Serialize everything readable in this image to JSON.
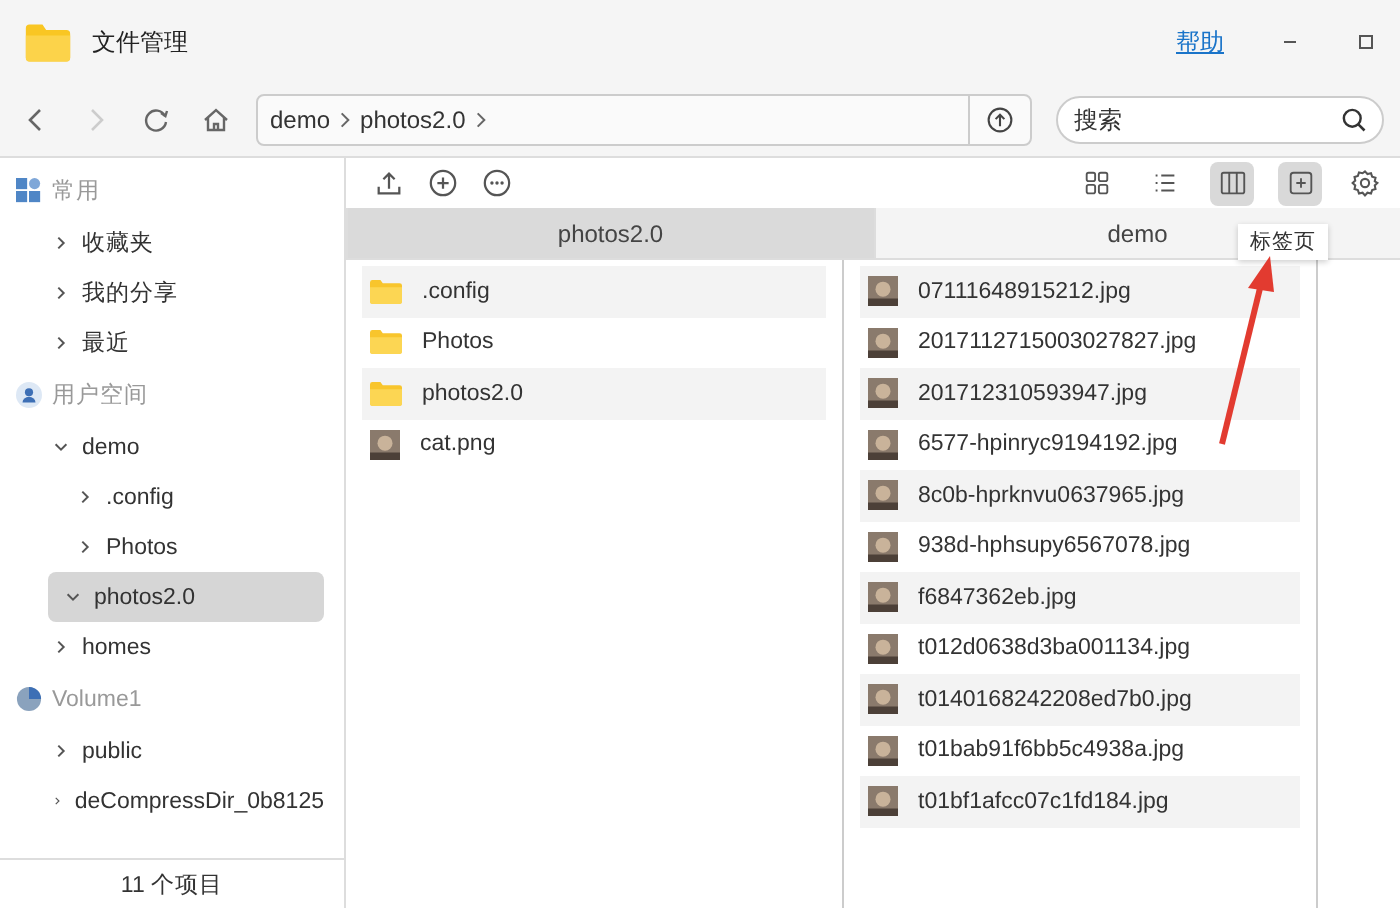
{
  "window": {
    "title": "文件管理",
    "help_link": "帮助"
  },
  "nav": {
    "path": [
      "demo",
      "photos2.0"
    ],
    "search": {
      "placeholder": "搜索"
    }
  },
  "sidebar": {
    "sections": [
      {
        "kind": "common",
        "label": "常用",
        "items": [
          {
            "label": "收藏夹",
            "expanded": false,
            "selected": false
          },
          {
            "label": "我的分享",
            "expanded": false,
            "selected": false
          },
          {
            "label": "最近",
            "expanded": false,
            "selected": false
          }
        ]
      },
      {
        "kind": "user",
        "label": "用户空间",
        "items": [
          {
            "label": "demo",
            "expanded": true,
            "selected": false,
            "children": [
              {
                "label": ".config",
                "expanded": false,
                "selected": false
              },
              {
                "label": "Photos",
                "expanded": false,
                "selected": false
              },
              {
                "label": "photos2.0",
                "expanded": true,
                "selected": true
              }
            ]
          },
          {
            "label": "homes",
            "expanded": false,
            "selected": false
          }
        ]
      },
      {
        "kind": "volume",
        "label": "Volume1",
        "items": [
          {
            "label": "public",
            "expanded": false,
            "selected": false
          },
          {
            "label": "deCompressDir_0b8125",
            "expanded": false,
            "selected": false
          }
        ]
      }
    ]
  },
  "status_bar": {
    "text": "11 个项目"
  },
  "toolbar": {
    "views": [
      {
        "kind": "grid",
        "selected": false
      },
      {
        "kind": "list",
        "selected": false
      },
      {
        "kind": "columns",
        "selected": true
      }
    ],
    "new_tab": {
      "highlighted": true,
      "tooltip": "标签页"
    }
  },
  "tabs": [
    {
      "label": "photos2.0",
      "selected": true
    },
    {
      "label": "demo",
      "selected": false
    }
  ],
  "columns": [
    {
      "items": [
        {
          "name": ".config",
          "kind": "folder"
        },
        {
          "name": "Photos",
          "kind": "folder"
        },
        {
          "name": "photos2.0",
          "kind": "folder"
        },
        {
          "name": "cat.png",
          "kind": "image"
        }
      ]
    },
    {
      "items": [
        {
          "name": "07111648915212.jpg",
          "kind": "image"
        },
        {
          "name": "2017112715003027827.jpg",
          "kind": "image"
        },
        {
          "name": "201712310593947.jpg",
          "kind": "image"
        },
        {
          "name": "6577-hpinryc9194192.jpg",
          "kind": "image"
        },
        {
          "name": "8c0b-hprknvu0637965.jpg",
          "kind": "image"
        },
        {
          "name": "938d-hphsupy6567078.jpg",
          "kind": "image"
        },
        {
          "name": "f6847362eb.jpg",
          "kind": "image"
        },
        {
          "name": "t012d0638d3ba001134.jpg",
          "kind": "image"
        },
        {
          "name": "t0140168242208ed7b0.jpg",
          "kind": "image"
        },
        {
          "name": "t01bab91f6bb5c4938a.jpg",
          "kind": "image"
        },
        {
          "name": "t01bf1afcc07c1fd184.jpg",
          "kind": "image"
        }
      ]
    }
  ]
}
